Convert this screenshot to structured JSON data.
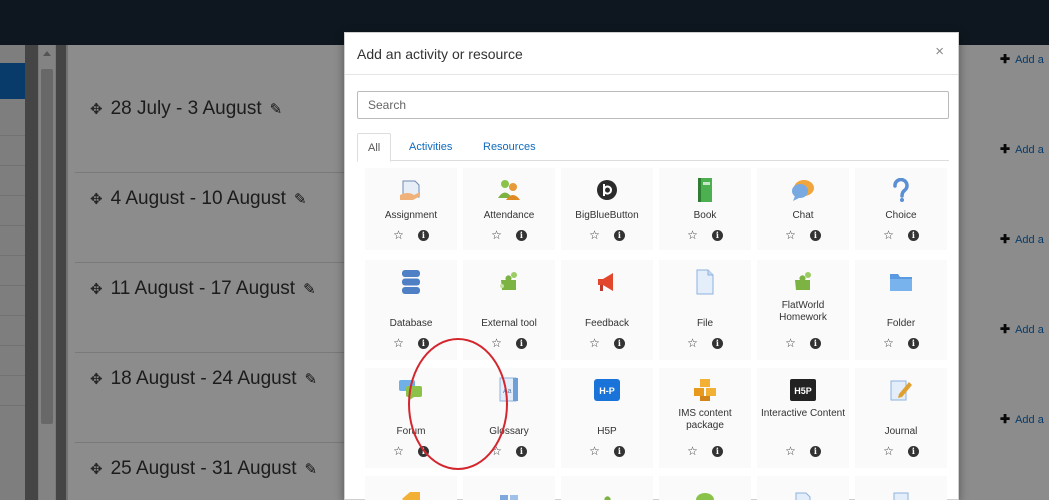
{
  "page": {
    "weeks": [
      {
        "label": "28 July - 3 August"
      },
      {
        "label": "4 August - 10 August"
      },
      {
        "label": "11 August - 17 August"
      },
      {
        "label": "18 August - 24 August"
      },
      {
        "label": "25 August - 31 August"
      }
    ],
    "add_label": "Add a"
  },
  "modal": {
    "title": "Add an activity or resource",
    "close_icon": "×",
    "search_placeholder": "Search",
    "tabs": [
      "All",
      "Activities",
      "Resources"
    ],
    "tiles": [
      {
        "label": "Assignment",
        "icon": "assignment-icon"
      },
      {
        "label": "Attendance",
        "icon": "attendance-icon"
      },
      {
        "label": "BigBlueButton",
        "icon": "bigbluebutton-icon"
      },
      {
        "label": "Book",
        "icon": "book-icon"
      },
      {
        "label": "Chat",
        "icon": "chat-icon"
      },
      {
        "label": "Choice",
        "icon": "choice-icon"
      },
      {
        "label": "Database",
        "icon": "database-icon"
      },
      {
        "label": "External tool",
        "icon": "external-tool-icon"
      },
      {
        "label": "Feedback",
        "icon": "feedback-icon"
      },
      {
        "label": "File",
        "icon": "file-icon"
      },
      {
        "label": "FlatWorld Homework",
        "icon": "flatworld-icon"
      },
      {
        "label": "Folder",
        "icon": "folder-icon"
      },
      {
        "label": "Forum",
        "icon": "forum-icon"
      },
      {
        "label": "Glossary",
        "icon": "glossary-icon"
      },
      {
        "label": "H5P",
        "icon": "h5p-icon"
      },
      {
        "label": "IMS content package",
        "icon": "ims-package-icon"
      },
      {
        "label": "Interactive Content",
        "icon": "interactive-content-icon"
      },
      {
        "label": "Journal",
        "icon": "journal-icon"
      }
    ],
    "h5p_logo_text": "H5P"
  },
  "colors": {
    "accent": "#0f6cbf",
    "topbar": "#1b2a3a",
    "annotation": "#d4262e"
  }
}
